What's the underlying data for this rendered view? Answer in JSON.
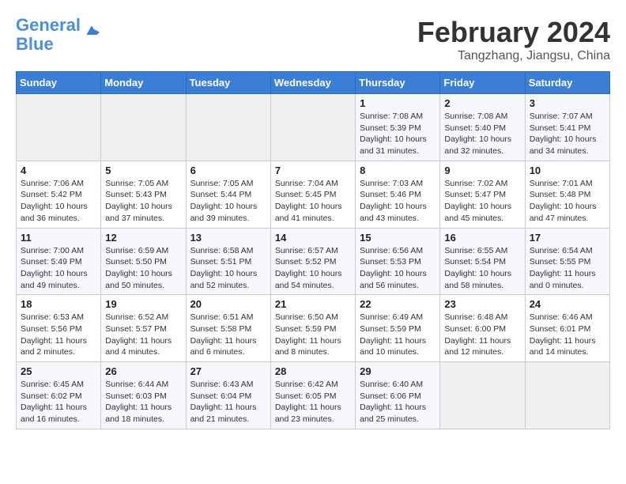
{
  "header": {
    "logo_line1": "General",
    "logo_line2": "Blue",
    "main_title": "February 2024",
    "subtitle": "Tangzhang, Jiangsu, China"
  },
  "weekdays": [
    "Sunday",
    "Monday",
    "Tuesday",
    "Wednesday",
    "Thursday",
    "Friday",
    "Saturday"
  ],
  "weeks": [
    [
      {
        "day": "",
        "info": ""
      },
      {
        "day": "",
        "info": ""
      },
      {
        "day": "",
        "info": ""
      },
      {
        "day": "",
        "info": ""
      },
      {
        "day": "1",
        "info": "Sunrise: 7:08 AM\nSunset: 5:39 PM\nDaylight: 10 hours\nand 31 minutes."
      },
      {
        "day": "2",
        "info": "Sunrise: 7:08 AM\nSunset: 5:40 PM\nDaylight: 10 hours\nand 32 minutes."
      },
      {
        "day": "3",
        "info": "Sunrise: 7:07 AM\nSunset: 5:41 PM\nDaylight: 10 hours\nand 34 minutes."
      }
    ],
    [
      {
        "day": "4",
        "info": "Sunrise: 7:06 AM\nSunset: 5:42 PM\nDaylight: 10 hours\nand 36 minutes."
      },
      {
        "day": "5",
        "info": "Sunrise: 7:05 AM\nSunset: 5:43 PM\nDaylight: 10 hours\nand 37 minutes."
      },
      {
        "day": "6",
        "info": "Sunrise: 7:05 AM\nSunset: 5:44 PM\nDaylight: 10 hours\nand 39 minutes."
      },
      {
        "day": "7",
        "info": "Sunrise: 7:04 AM\nSunset: 5:45 PM\nDaylight: 10 hours\nand 41 minutes."
      },
      {
        "day": "8",
        "info": "Sunrise: 7:03 AM\nSunset: 5:46 PM\nDaylight: 10 hours\nand 43 minutes."
      },
      {
        "day": "9",
        "info": "Sunrise: 7:02 AM\nSunset: 5:47 PM\nDaylight: 10 hours\nand 45 minutes."
      },
      {
        "day": "10",
        "info": "Sunrise: 7:01 AM\nSunset: 5:48 PM\nDaylight: 10 hours\nand 47 minutes."
      }
    ],
    [
      {
        "day": "11",
        "info": "Sunrise: 7:00 AM\nSunset: 5:49 PM\nDaylight: 10 hours\nand 49 minutes."
      },
      {
        "day": "12",
        "info": "Sunrise: 6:59 AM\nSunset: 5:50 PM\nDaylight: 10 hours\nand 50 minutes."
      },
      {
        "day": "13",
        "info": "Sunrise: 6:58 AM\nSunset: 5:51 PM\nDaylight: 10 hours\nand 52 minutes."
      },
      {
        "day": "14",
        "info": "Sunrise: 6:57 AM\nSunset: 5:52 PM\nDaylight: 10 hours\nand 54 minutes."
      },
      {
        "day": "15",
        "info": "Sunrise: 6:56 AM\nSunset: 5:53 PM\nDaylight: 10 hours\nand 56 minutes."
      },
      {
        "day": "16",
        "info": "Sunrise: 6:55 AM\nSunset: 5:54 PM\nDaylight: 10 hours\nand 58 minutes."
      },
      {
        "day": "17",
        "info": "Sunrise: 6:54 AM\nSunset: 5:55 PM\nDaylight: 11 hours\nand 0 minutes."
      }
    ],
    [
      {
        "day": "18",
        "info": "Sunrise: 6:53 AM\nSunset: 5:56 PM\nDaylight: 11 hours\nand 2 minutes."
      },
      {
        "day": "19",
        "info": "Sunrise: 6:52 AM\nSunset: 5:57 PM\nDaylight: 11 hours\nand 4 minutes."
      },
      {
        "day": "20",
        "info": "Sunrise: 6:51 AM\nSunset: 5:58 PM\nDaylight: 11 hours\nand 6 minutes."
      },
      {
        "day": "21",
        "info": "Sunrise: 6:50 AM\nSunset: 5:59 PM\nDaylight: 11 hours\nand 8 minutes."
      },
      {
        "day": "22",
        "info": "Sunrise: 6:49 AM\nSunset: 5:59 PM\nDaylight: 11 hours\nand 10 minutes."
      },
      {
        "day": "23",
        "info": "Sunrise: 6:48 AM\nSunset: 6:00 PM\nDaylight: 11 hours\nand 12 minutes."
      },
      {
        "day": "24",
        "info": "Sunrise: 6:46 AM\nSunset: 6:01 PM\nDaylight: 11 hours\nand 14 minutes."
      }
    ],
    [
      {
        "day": "25",
        "info": "Sunrise: 6:45 AM\nSunset: 6:02 PM\nDaylight: 11 hours\nand 16 minutes."
      },
      {
        "day": "26",
        "info": "Sunrise: 6:44 AM\nSunset: 6:03 PM\nDaylight: 11 hours\nand 18 minutes."
      },
      {
        "day": "27",
        "info": "Sunrise: 6:43 AM\nSunset: 6:04 PM\nDaylight: 11 hours\nand 21 minutes."
      },
      {
        "day": "28",
        "info": "Sunrise: 6:42 AM\nSunset: 6:05 PM\nDaylight: 11 hours\nand 23 minutes."
      },
      {
        "day": "29",
        "info": "Sunrise: 6:40 AM\nSunset: 6:06 PM\nDaylight: 11 hours\nand 25 minutes."
      },
      {
        "day": "",
        "info": ""
      },
      {
        "day": "",
        "info": ""
      }
    ]
  ]
}
